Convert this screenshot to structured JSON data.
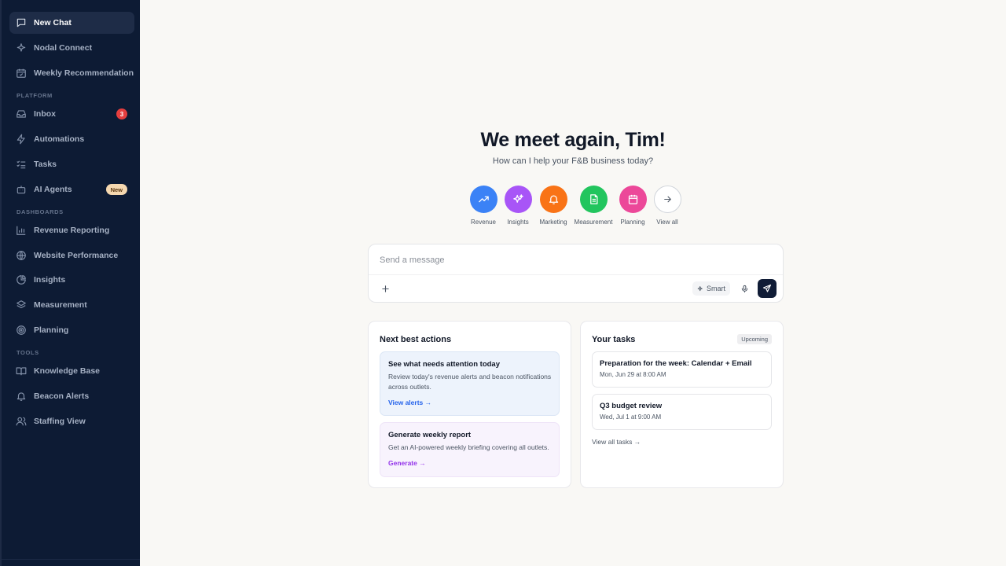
{
  "sidebar": {
    "items": [
      {
        "label": "New Chat",
        "icon": "chat-icon"
      },
      {
        "label": "Nodal Connect",
        "icon": "sparkle-icon"
      },
      {
        "label": "Weekly Recommendation",
        "icon": "calendar-check-icon"
      },
      {
        "label": "Inbox",
        "icon": "inbox-icon",
        "badge": "3"
      },
      {
        "label": "Automations",
        "icon": "lightning-icon"
      },
      {
        "label": "Tasks",
        "icon": "list-check-icon"
      },
      {
        "label": "AI Agents",
        "icon": "robot-icon",
        "badge": "New"
      },
      {
        "label": "Revenue Reporting",
        "icon": "bar-chart-icon"
      },
      {
        "label": "Website Performance",
        "icon": "globe-icon"
      },
      {
        "label": "Insights",
        "icon": "pie-chart-icon"
      },
      {
        "label": "Measurement",
        "icon": "layers-icon"
      },
      {
        "label": "Planning",
        "icon": "target-icon"
      },
      {
        "label": "Knowledge Base",
        "icon": "book-icon"
      },
      {
        "label": "Beacon Alerts",
        "icon": "bell-icon"
      },
      {
        "label": "Staffing View",
        "icon": "users-icon"
      }
    ],
    "sections": {
      "platform": "PLATFORM",
      "dashboards": "DASHBOARDS",
      "tools": "TOOLS"
    }
  },
  "hero": {
    "title": "We meet again, Tim!",
    "subtitle": "How can I help your F&B business today?"
  },
  "quick_actions": [
    {
      "label": "Revenue",
      "icon": "trend-up-icon",
      "color": "#3b82f6"
    },
    {
      "label": "Insights",
      "icon": "sparkles-icon",
      "color": "#a855f7"
    },
    {
      "label": "Marketing",
      "icon": "bell-icon",
      "color": "#f97316"
    },
    {
      "label": "Measurement",
      "icon": "document-icon",
      "color": "#22c55e"
    },
    {
      "label": "Planning",
      "icon": "calendar-icon",
      "color": "#ec4899"
    },
    {
      "label": "View all",
      "icon": "arrow-right-icon",
      "color": "#ffffff"
    }
  ],
  "composer": {
    "placeholder": "Send a message",
    "smart_label": "Smart"
  },
  "next_actions": {
    "title": "Next best actions",
    "items": [
      {
        "title": "See what needs attention today",
        "description": "Review today's revenue alerts and beacon notifications across outlets.",
        "link": "View alerts →",
        "bg": "#edf3fc",
        "link_color": "#2563eb"
      },
      {
        "title": "Generate weekly report",
        "description": "Get an AI-powered weekly briefing covering all outlets.",
        "link": "Generate →",
        "bg": "#f8f3fd",
        "link_color": "#9333ea"
      }
    ]
  },
  "tasks": {
    "title": "Your tasks",
    "badge": "Upcoming",
    "items": [
      {
        "title": "Preparation for the week: Calendar + Email",
        "meta": "Mon, Jun 29 at 8:00 AM"
      },
      {
        "title": "Q3 budget review",
        "meta": "Wed, Jul 1 at 9:00 AM"
      }
    ],
    "view_all": "View all tasks →"
  }
}
